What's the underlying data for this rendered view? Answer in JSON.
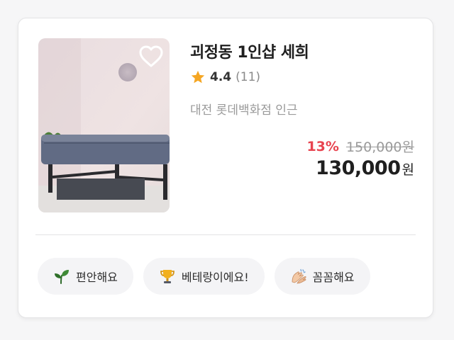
{
  "listing": {
    "title": "괴정동 1인샵 세희",
    "rating": "4.4",
    "review_count": "(11)",
    "location": "대전 롯데백화점 인근",
    "discount_percent": "13%",
    "original_price": "150,000원",
    "price": "130,000",
    "currency_unit": "원",
    "photo_icon": "massage-room-photo",
    "favorite_icon": "heart-outline-icon"
  },
  "tags": [
    {
      "label": "편안해요",
      "icon": "sprout-icon"
    },
    {
      "label": "베테랑이에요!",
      "icon": "trophy-icon"
    },
    {
      "label": "꼼꼼해요",
      "icon": "hands-icon"
    }
  ],
  "colors": {
    "discount": "#e8434f",
    "star": "#f5a623",
    "muted_text": "#9a9a9a",
    "tag_background": "#f4f4f6"
  }
}
